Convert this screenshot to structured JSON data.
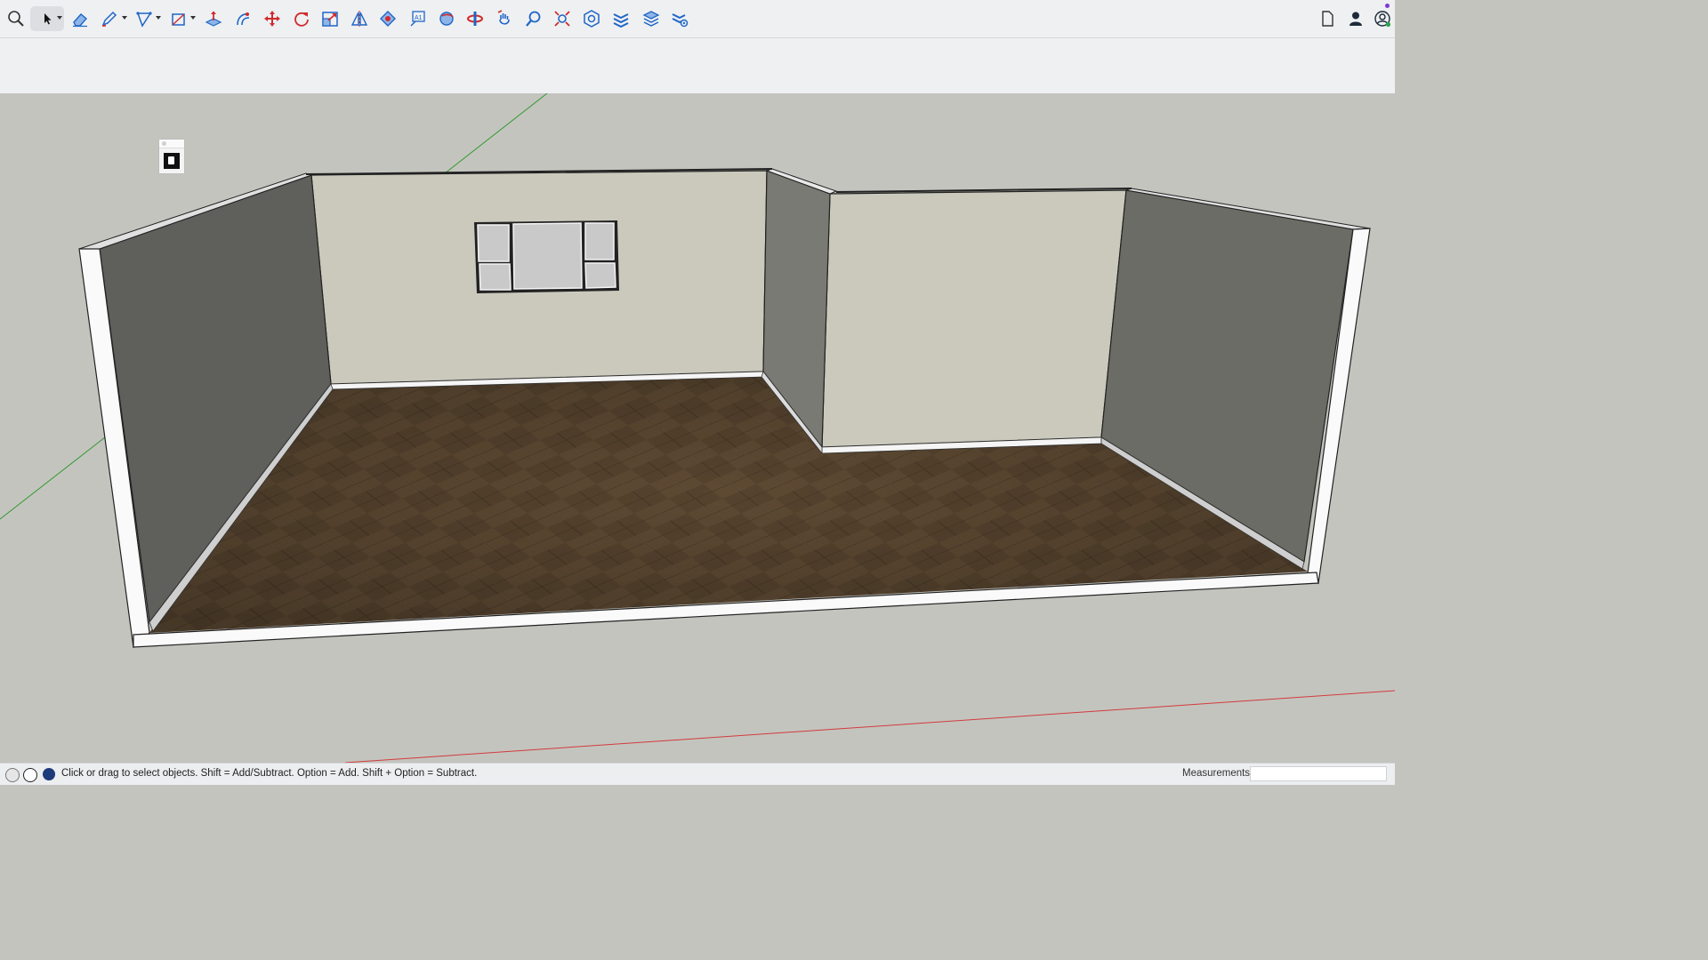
{
  "toolbar": {
    "tools": [
      {
        "name": "search-icon"
      },
      {
        "name": "select-arrow-icon"
      },
      {
        "name": "eraser-icon"
      },
      {
        "name": "pencil-icon"
      },
      {
        "name": "arc-icon"
      },
      {
        "name": "shape-icon"
      },
      {
        "name": "push-pull-icon"
      },
      {
        "name": "follow-me-icon"
      },
      {
        "name": "move-icon"
      },
      {
        "name": "rotate-icon"
      },
      {
        "name": "scale-icon"
      },
      {
        "name": "flip-icon"
      },
      {
        "name": "paint-bucket-icon"
      },
      {
        "name": "text-icon"
      },
      {
        "name": "orbit-icon"
      },
      {
        "name": "pan-icon"
      },
      {
        "name": "walk-icon"
      },
      {
        "name": "zoom-icon"
      },
      {
        "name": "zoom-extents-icon"
      },
      {
        "name": "component-icon"
      },
      {
        "name": "tags-icon"
      },
      {
        "name": "layers-icon"
      },
      {
        "name": "settings-layers-icon"
      }
    ],
    "right_icons": [
      "document-icon",
      "user-icon",
      "account-icon"
    ],
    "accent": "#1f66c7"
  },
  "statusbar": {
    "hint": "Click or drag to select objects. Shift = Add/Subtract. Option = Add. Shift + Option = Subtract.",
    "measurements_label": "Measurements",
    "measurements_value": ""
  },
  "colors": {
    "background": "#c4c4bf",
    "wall_light": "#cbc9bc",
    "wall_dark": "#6b6b66",
    "floor": "#56432e"
  }
}
